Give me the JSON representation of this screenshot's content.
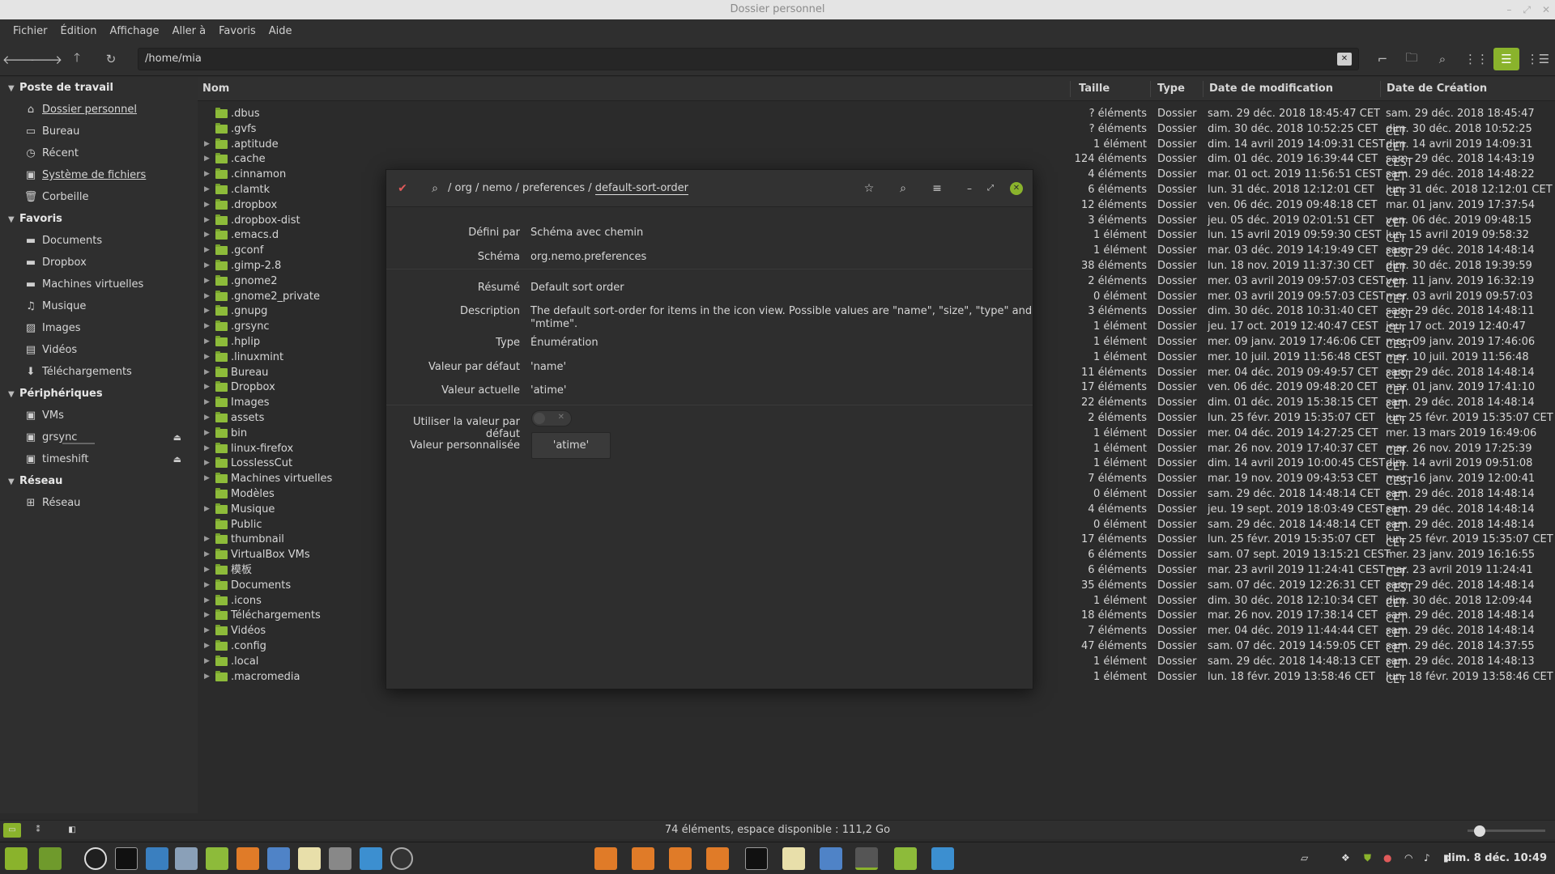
{
  "window": {
    "title": "Dossier personnel"
  },
  "menubar": [
    "Fichier",
    "Édition",
    "Affichage",
    "Aller à",
    "Favoris",
    "Aide"
  ],
  "toolbar": {
    "path": "/home/mia"
  },
  "sidebar": {
    "sections": [
      {
        "title": "Poste de travail",
        "items": [
          {
            "label": "Dossier personnel",
            "icon": "home-icon"
          },
          {
            "label": "Bureau",
            "icon": "desktop-icon"
          },
          {
            "label": "Récent",
            "icon": "clock-icon"
          },
          {
            "label": "Système de fichiers",
            "icon": "drive-icon"
          },
          {
            "label": "Corbeille",
            "icon": "trash-icon"
          }
        ]
      },
      {
        "title": "Favoris",
        "items": [
          {
            "label": "Documents",
            "icon": "folder-icon"
          },
          {
            "label": "Dropbox",
            "icon": "folder-icon"
          },
          {
            "label": "Machines virtuelles",
            "icon": "folder-icon"
          },
          {
            "label": "Musique",
            "icon": "music-icon"
          },
          {
            "label": "Images",
            "icon": "image-icon"
          },
          {
            "label": "Vidéos",
            "icon": "video-icon"
          },
          {
            "label": "Téléchargements",
            "icon": "download-icon"
          }
        ]
      },
      {
        "title": "Périphériques",
        "items": [
          {
            "label": "VMs",
            "icon": "drive-icon"
          },
          {
            "label": "grsync",
            "icon": "drive-icon"
          },
          {
            "label": "timeshift",
            "icon": "drive-icon"
          }
        ]
      },
      {
        "title": "Réseau",
        "items": [
          {
            "label": "Réseau",
            "icon": "network-icon"
          }
        ]
      }
    ]
  },
  "columns": {
    "name": "Nom",
    "size": "Taille",
    "type": "Type",
    "modified": "Date de modification",
    "created": "Date de Création"
  },
  "files": [
    [
      ".dbus",
      "? éléments",
      "Dossier",
      "sam. 29 déc. 2018 18:45:47 CET",
      "sam. 29 déc. 2018 18:45:47 CET"
    ],
    [
      ".gvfs",
      "? éléments",
      "Dossier",
      "dim. 30 déc. 2018 10:52:25 CET",
      "dim. 30 déc. 2018 10:52:25 CET"
    ],
    [
      ".aptitude",
      "1 élément",
      "Dossier",
      "dim. 14 avril 2019 14:09:31 CEST",
      "dim. 14 avril 2019 14:09:31 CEST"
    ],
    [
      ".cache",
      "124 éléments",
      "Dossier",
      "dim. 01 déc. 2019 16:39:44 CET",
      "sam. 29 déc. 2018 14:43:19 CET"
    ],
    [
      ".cinnamon",
      "4 éléments",
      "Dossier",
      "mar. 01 oct. 2019 11:56:51 CEST",
      "sam. 29 déc. 2018 14:48:22 CET"
    ],
    [
      ".clamtk",
      "6 éléments",
      "Dossier",
      "lun. 31 déc. 2018 12:12:01 CET",
      "lun. 31 déc. 2018 12:12:01 CET"
    ],
    [
      ".dropbox",
      "12 éléments",
      "Dossier",
      "ven. 06 déc. 2019 09:48:18 CET",
      "mar. 01 janv. 2019 17:37:54 CET"
    ],
    [
      ".dropbox-dist",
      "3 éléments",
      "Dossier",
      "jeu. 05 déc. 2019 02:01:51 CET",
      "ven. 06 déc. 2019 09:48:15 CET"
    ],
    [
      ".emacs.d",
      "1 élément",
      "Dossier",
      "lun. 15 avril 2019 09:59:30 CEST",
      "lun. 15 avril 2019 09:58:32 CEST"
    ],
    [
      ".gconf",
      "1 élément",
      "Dossier",
      "mar. 03 déc. 2019 14:19:49 CET",
      "sam. 29 déc. 2018 14:48:14 CET"
    ],
    [
      ".gimp-2.8",
      "38 éléments",
      "Dossier",
      "lun. 18 nov. 2019 11:37:30 CET",
      "dim. 30 déc. 2018 19:39:59 CET"
    ],
    [
      ".gnome2",
      "2 éléments",
      "Dossier",
      "mer. 03 avril 2019 09:57:03 CEST",
      "ven. 11 janv. 2019 16:32:19 CET"
    ],
    [
      ".gnome2_private",
      "0 élément",
      "Dossier",
      "mer. 03 avril 2019 09:57:03 CEST",
      "mer. 03 avril 2019 09:57:03 CEST"
    ],
    [
      ".gnupg",
      "3 éléments",
      "Dossier",
      "dim. 30 déc. 2018 10:31:40 CET",
      "sam. 29 déc. 2018 14:48:11 CET"
    ],
    [
      ".grsync",
      "1 élément",
      "Dossier",
      "jeu. 17 oct. 2019 12:40:47 CEST",
      "jeu. 17 oct. 2019 12:40:47 CEST"
    ],
    [
      ".hplip",
      "1 élément",
      "Dossier",
      "mer. 09 janv. 2019 17:46:06 CET",
      "mer. 09 janv. 2019 17:46:06 CET"
    ],
    [
      ".linuxmint",
      "1 élément",
      "Dossier",
      "mer. 10 juil. 2019 11:56:48 CEST",
      "mer. 10 juil. 2019 11:56:48 CEST"
    ],
    [
      "Bureau",
      "11 éléments",
      "Dossier",
      "mer. 04 déc. 2019 09:49:57 CET",
      "sam. 29 déc. 2018 14:48:14 CET"
    ],
    [
      "Dropbox",
      "17 éléments",
      "Dossier",
      "ven. 06 déc. 2019 09:48:20 CET",
      "mar. 01 janv. 2019 17:41:10 CET"
    ],
    [
      "Images",
      "22 éléments",
      "Dossier",
      "dim. 01 déc. 2019 15:38:15 CET",
      "sam. 29 déc. 2018 14:48:14 CET"
    ],
    [
      "assets",
      "2 éléments",
      "Dossier",
      "lun. 25 févr. 2019 15:35:07 CET",
      "lun. 25 févr. 2019 15:35:07 CET"
    ],
    [
      "bin",
      "1 élément",
      "Dossier",
      "mer. 04 déc. 2019 14:27:25 CET",
      "mer. 13 mars 2019 16:49:06 CET"
    ],
    [
      "linux-firefox",
      "1 élément",
      "Dossier",
      "mar. 26 nov. 2019 17:40:37 CET",
      "mar. 26 nov. 2019 17:25:39 CET"
    ],
    [
      "LosslessCut",
      "1 élément",
      "Dossier",
      "dim. 14 avril 2019 10:00:45 CEST",
      "dim. 14 avril 2019 09:51:08 CEST"
    ],
    [
      "Machines virtuelles",
      "7 éléments",
      "Dossier",
      "mar. 19 nov. 2019 09:43:53 CET",
      "mer. 16 janv. 2019 12:00:41 CET"
    ],
    [
      "Modèles",
      "0 élément",
      "Dossier",
      "sam. 29 déc. 2018 14:48:14 CET",
      "sam. 29 déc. 2018 14:48:14 CET"
    ],
    [
      "Musique",
      "4 éléments",
      "Dossier",
      "jeu. 19 sept. 2019 18:03:49 CEST",
      "sam. 29 déc. 2018 14:48:14 CET"
    ],
    [
      "Public",
      "0 élément",
      "Dossier",
      "sam. 29 déc. 2018 14:48:14 CET",
      "sam. 29 déc. 2018 14:48:14 CET"
    ],
    [
      "thumbnail",
      "17 éléments",
      "Dossier",
      "lun. 25 févr. 2019 15:35:07 CET",
      "lun. 25 févr. 2019 15:35:07 CET"
    ],
    [
      "VirtualBox VMs",
      "6 éléments",
      "Dossier",
      "sam. 07 sept. 2019 13:15:21 CEST",
      "mer. 23 janv. 2019 16:16:55 CET"
    ],
    [
      "模板",
      "6 éléments",
      "Dossier",
      "mar. 23 avril 2019 11:24:41 CEST",
      "mar. 23 avril 2019 11:24:41 CEST"
    ],
    [
      "Documents",
      "35 éléments",
      "Dossier",
      "sam. 07 déc. 2019 12:26:31 CET",
      "sam. 29 déc. 2018 14:48:14 CET"
    ],
    [
      ".icons",
      "1 élément",
      "Dossier",
      "dim. 30 déc. 2018 12:10:34 CET",
      "dim. 30 déc. 2018 12:09:44 CET"
    ],
    [
      "Téléchargements",
      "18 éléments",
      "Dossier",
      "mar. 26 nov. 2019 17:38:14 CET",
      "sam. 29 déc. 2018 14:48:14 CET"
    ],
    [
      "Vidéos",
      "7 éléments",
      "Dossier",
      "mer. 04 déc. 2019 11:44:44 CET",
      "sam. 29 déc. 2018 14:48:14 CET"
    ],
    [
      ".config",
      "47 éléments",
      "Dossier",
      "sam. 07 déc. 2019 14:59:05 CET",
      "sam. 29 déc. 2018 14:37:55 CET"
    ],
    [
      ".local",
      "1 élément",
      "Dossier",
      "sam. 29 déc. 2018 14:48:13 CET",
      "sam. 29 déc. 2018 14:48:13 CET"
    ],
    [
      ".macromedia",
      "1 élément",
      "Dossier",
      "lun. 18 févr. 2019 13:58:46 CET",
      "lun. 18 févr. 2019 13:58:46 CET"
    ]
  ],
  "status": {
    "text": "74 éléments, espace disponible : 111,2 Go"
  },
  "dialog": {
    "breadcrumb": [
      "org",
      "nemo",
      "preferences"
    ],
    "current_key": "default-sort-order",
    "defined_by_label": "Défini par",
    "defined_by": "Schéma avec chemin",
    "schema_label": "Schéma",
    "schema": "org.nemo.preferences",
    "summary_label": "Résumé",
    "summary": "Default sort order",
    "description_label": "Description",
    "description_line1": "The default sort-order for items in the icon view. Possible values are \"name\", \"size\", \"type\" and",
    "description_line2": "\"mtime\".",
    "type_label": "Type",
    "type": "Énumération",
    "default_label": "Valeur par défaut",
    "default": "'name'",
    "current_label": "Valeur actuelle",
    "current": "'atime'",
    "use_default_label": "Utiliser la valeur par défaut",
    "custom_label": "Valeur personnalisée",
    "custom": "'atime'"
  },
  "taskbar": {
    "clock": "dim. 8 déc. 10:49"
  },
  "colors": {
    "accent": "#8ab32c",
    "folder": "#8dbb3a"
  }
}
